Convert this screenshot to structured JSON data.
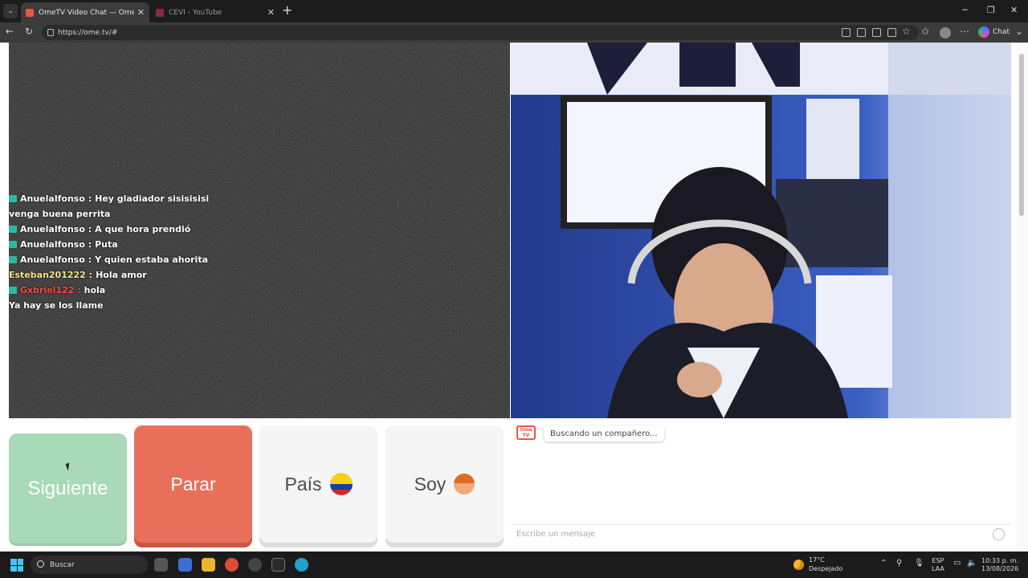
{
  "browser": {
    "tabs": [
      {
        "title": "OmeTV Video Chat — Omegl",
        "active": true
      },
      {
        "title": "CEVI - YouTube",
        "active": false
      }
    ],
    "url": "https://ome.tv/#",
    "chat_label": "Chat"
  },
  "remote_chat": {
    "messages": [
      {
        "sender": "Anuelalfonso :",
        "text": "Hey gladiador sisisisisi",
        "flag": true,
        "sender_color": "#ffffff"
      },
      {
        "sender": "",
        "text": "venga buena perrita",
        "flag": false,
        "sender_color": "#ffffff"
      },
      {
        "sender": "Anuelalfonso :",
        "text": "A que hora prendió",
        "flag": true,
        "sender_color": "#ffffff"
      },
      {
        "sender": "Anuelalfonso :",
        "text": "Puta",
        "flag": true,
        "sender_color": "#ffffff"
      },
      {
        "sender": "Anuelalfonso :",
        "text": "Y quien estaba ahorita",
        "flag": true,
        "sender_color": "#ffffff"
      },
      {
        "sender": "Esteban201222 :",
        "text": "Hola amor",
        "flag": false,
        "sender_color": "#f2e38a"
      },
      {
        "sender": "Gxbriel122 :",
        "text": "hola",
        "flag": true,
        "sender_color": "#ff4a3d"
      },
      {
        "sender": "",
        "text": "Ya hay se los llame",
        "flag": false,
        "sender_color": "#ffffff"
      }
    ]
  },
  "controls": {
    "next_label": "Siguiente",
    "stop_label": "Parar",
    "country_label": "País",
    "gender_label": "Soy"
  },
  "chat": {
    "logo_text": "Ome TV",
    "status": "Buscando un compañero...",
    "input_placeholder": "Escribe un mensaje"
  },
  "taskbar": {
    "search_label": "Buscar",
    "weather_temp": "17°C",
    "weather_desc": "Despejado",
    "lang_top": "ESP",
    "lang_bottom": "LAA",
    "time": "10:33 p. m.",
    "date": "13/08/2026"
  },
  "colors": {
    "next": "#a8d9b8",
    "stop": "#e86f5a",
    "accent": "#e8573f"
  }
}
